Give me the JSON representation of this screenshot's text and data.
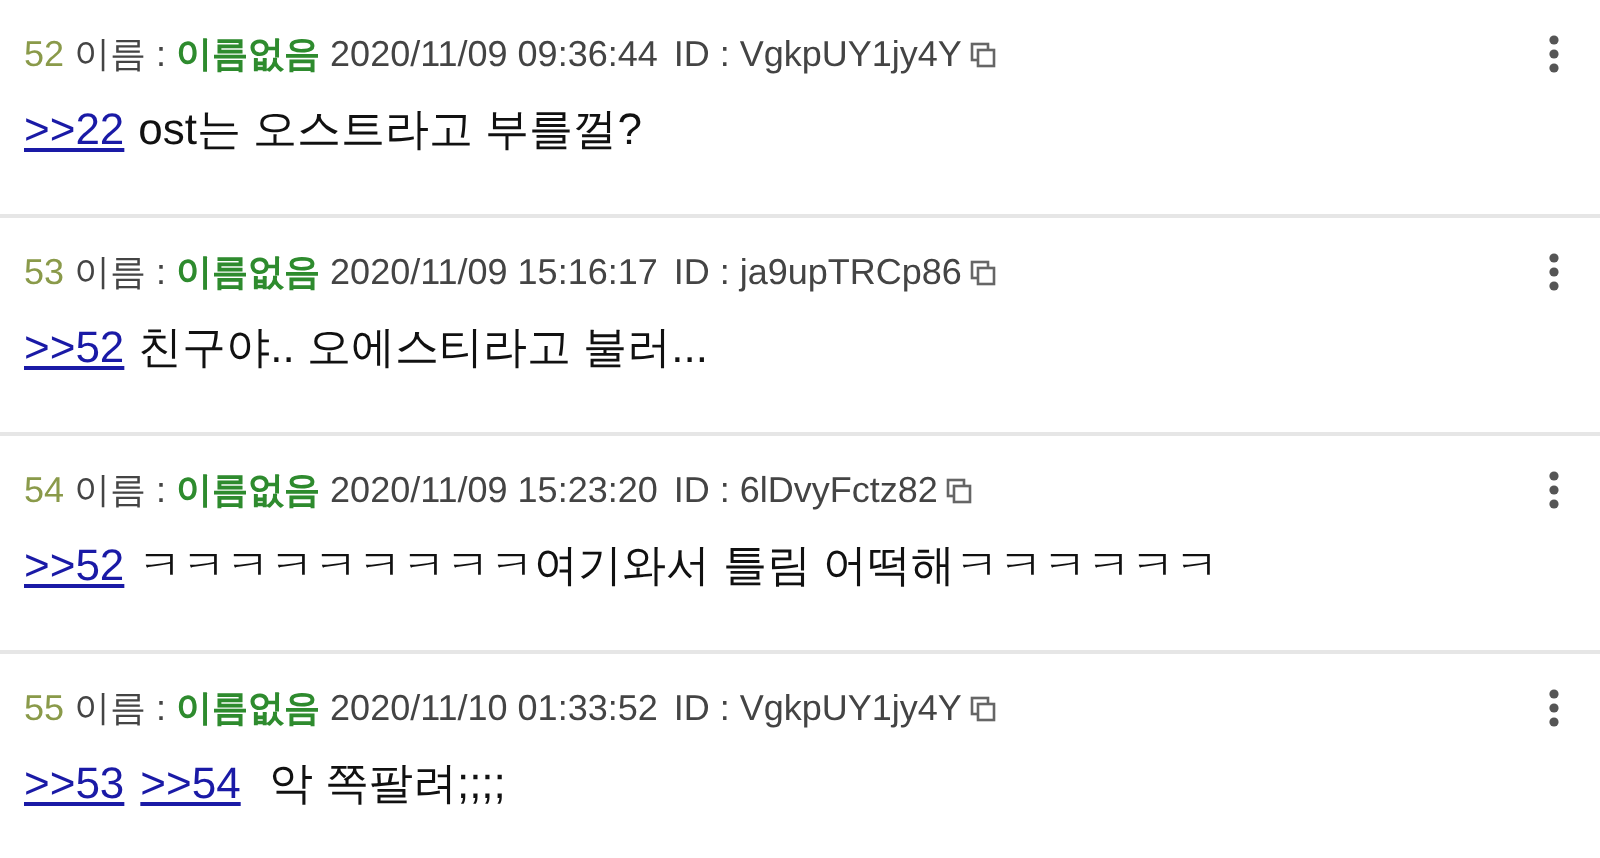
{
  "posts": [
    {
      "number": "52",
      "name_label": "이름 :",
      "name": "이름없음",
      "datetime": "2020/11/09 09:36:44",
      "id": "ID : VgkpUY1jy4Y",
      "anchors": [
        ">>22"
      ],
      "text": "ost는 오스트라고 부를껄?"
    },
    {
      "number": "53",
      "name_label": "이름 :",
      "name": "이름없음",
      "datetime": "2020/11/09 15:16:17",
      "id": "ID : ja9upTRCp86",
      "anchors": [
        ">>52"
      ],
      "text": "친구야.. 오에스티라고 불러..."
    },
    {
      "number": "54",
      "name_label": "이름 :",
      "name": "이름없음",
      "datetime": "2020/11/09 15:23:20",
      "id": "ID : 6lDvyFctz82",
      "anchors": [
        ">>52"
      ],
      "text": "ㅋㅋㅋㅋㅋㅋㅋㅋㅋ여기와서 틀림 어떡해ㅋㅋㅋㅋㅋㅋ"
    },
    {
      "number": "55",
      "name_label": "이름 :",
      "name": "이름없음",
      "datetime": "2020/11/10 01:33:52",
      "id": "ID : VgkpUY1jy4Y",
      "anchors": [
        ">>53",
        ">>54"
      ],
      "text": "악 쪽팔려;;;;"
    }
  ]
}
